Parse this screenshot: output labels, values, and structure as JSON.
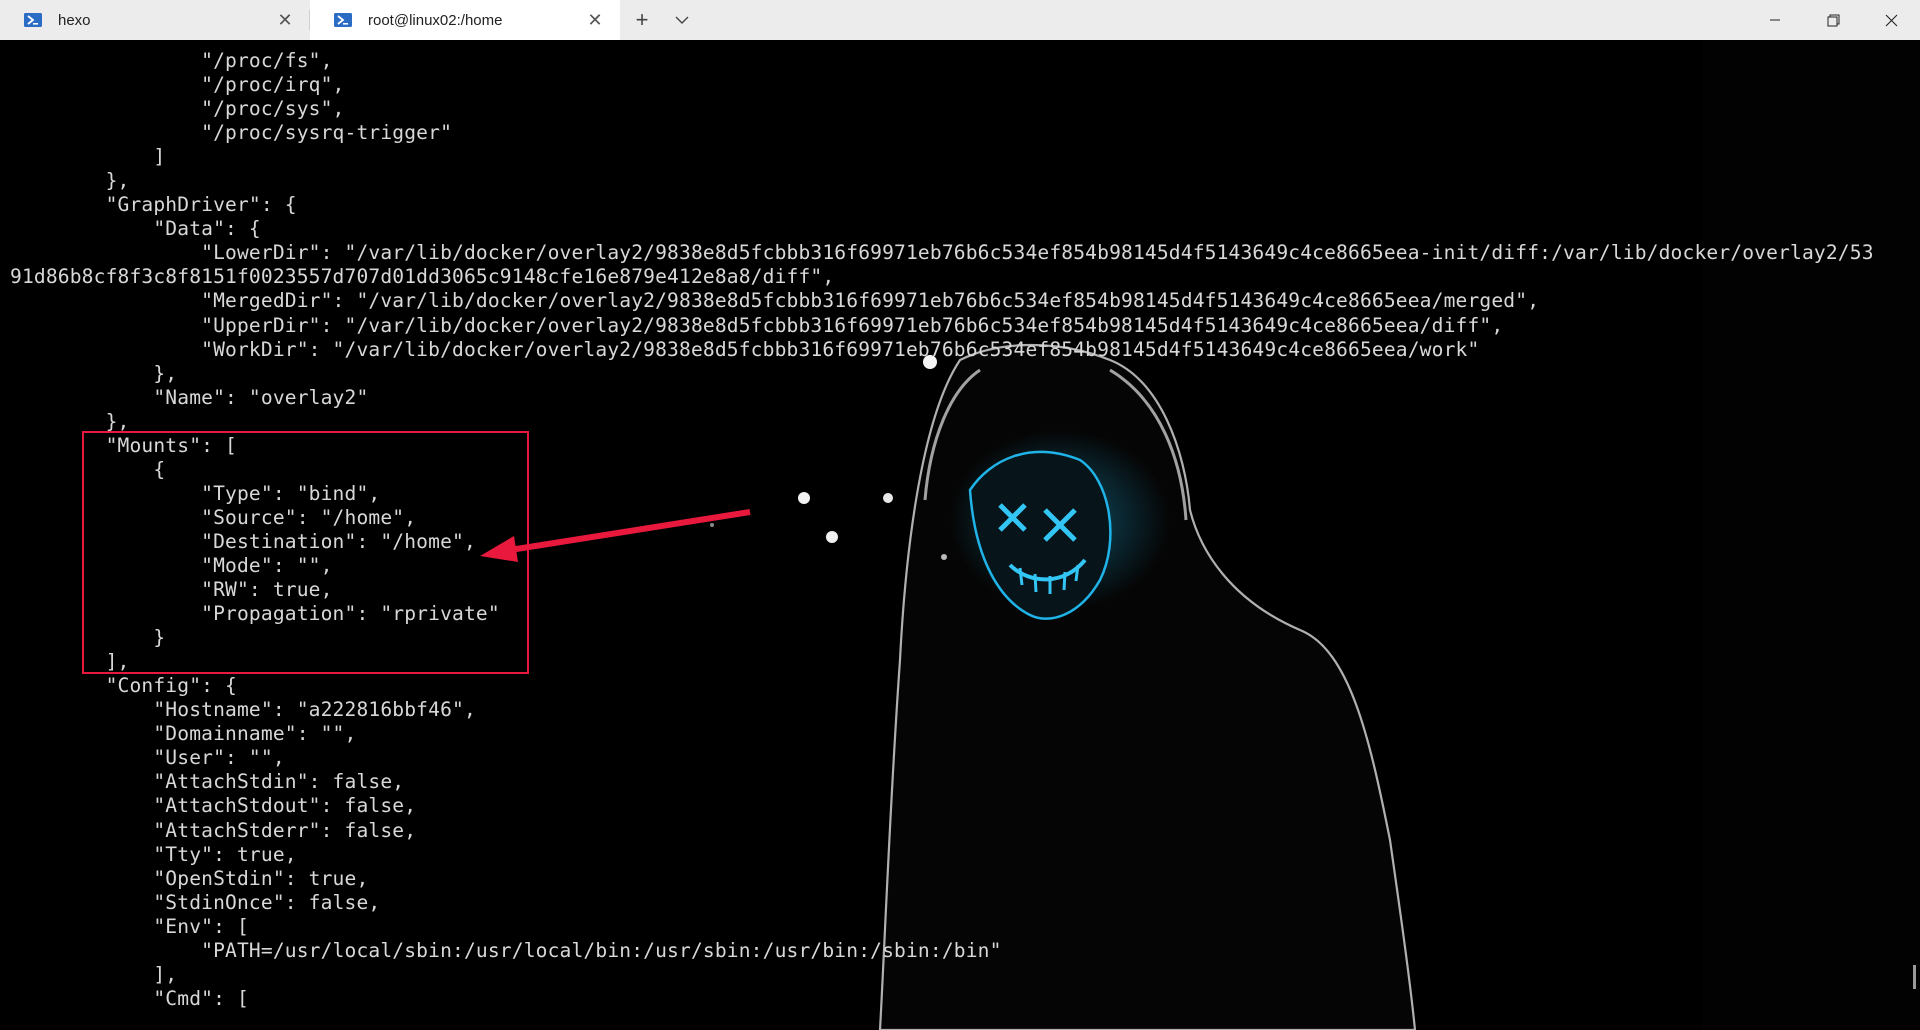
{
  "tabs": [
    {
      "label": "hexo",
      "icon": "powershell-icon",
      "active": false
    },
    {
      "label": "root@linux02:/home",
      "icon": "powershell-icon",
      "active": true
    }
  ],
  "tabbar": {
    "new_tab": "+",
    "dropdown": "chevron-down-icon"
  },
  "window_controls": [
    "minimize-icon",
    "restore-icon",
    "close-icon"
  ],
  "terminal": {
    "lines": [
      "                \"/proc/fs\",",
      "                \"/proc/irq\",",
      "                \"/proc/sys\",",
      "                \"/proc/sysrq-trigger\"",
      "            ]",
      "        },",
      "        \"GraphDriver\": {",
      "            \"Data\": {",
      "                \"LowerDir\": \"/var/lib/docker/overlay2/9838e8d5fcbbb316f69971eb76b6c534ef854b98145d4f5143649c4ce8665eea-init/diff:/var/lib/docker/overlay2/53",
      "91d86b8cf8f3c8f8151f0023557d707d01dd3065c9148cfe16e879e412e8a8/diff\",",
      "                \"MergedDir\": \"/var/lib/docker/overlay2/9838e8d5fcbbb316f69971eb76b6c534ef854b98145d4f5143649c4ce8665eea/merged\",",
      "                \"UpperDir\": \"/var/lib/docker/overlay2/9838e8d5fcbbb316f69971eb76b6c534ef854b98145d4f5143649c4ce8665eea/diff\",",
      "                \"WorkDir\": \"/var/lib/docker/overlay2/9838e8d5fcbbb316f69971eb76b6c534ef854b98145d4f5143649c4ce8665eea/work\"",
      "            },",
      "            \"Name\": \"overlay2\"",
      "        },",
      "        \"Mounts\": [",
      "            {",
      "                \"Type\": \"bind\",",
      "                \"Source\": \"/home\",",
      "                \"Destination\": \"/home\",",
      "                \"Mode\": \"\",",
      "                \"RW\": true,",
      "                \"Propagation\": \"rprivate\"",
      "            }",
      "        ],",
      "        \"Config\": {",
      "            \"Hostname\": \"a222816bbf46\",",
      "            \"Domainname\": \"\",",
      "            \"User\": \"\",",
      "            \"AttachStdin\": false,",
      "            \"AttachStdout\": false,",
      "            \"AttachStderr\": false,",
      "            \"Tty\": true,",
      "            \"OpenStdin\": true,",
      "            \"StdinOnce\": false,",
      "            \"Env\": [",
      "                \"PATH=/usr/local/sbin:/usr/local/bin:/usr/sbin:/usr/bin:/sbin:/bin\"",
      "            ],",
      "            \"Cmd\": ["
    ]
  },
  "annotation": {
    "box_color": "#e8193c",
    "arrow_color": "#e8193c"
  },
  "background": {
    "subject": "hooded-figure-neon-mask",
    "mask_color": "#1fb3e8"
  }
}
